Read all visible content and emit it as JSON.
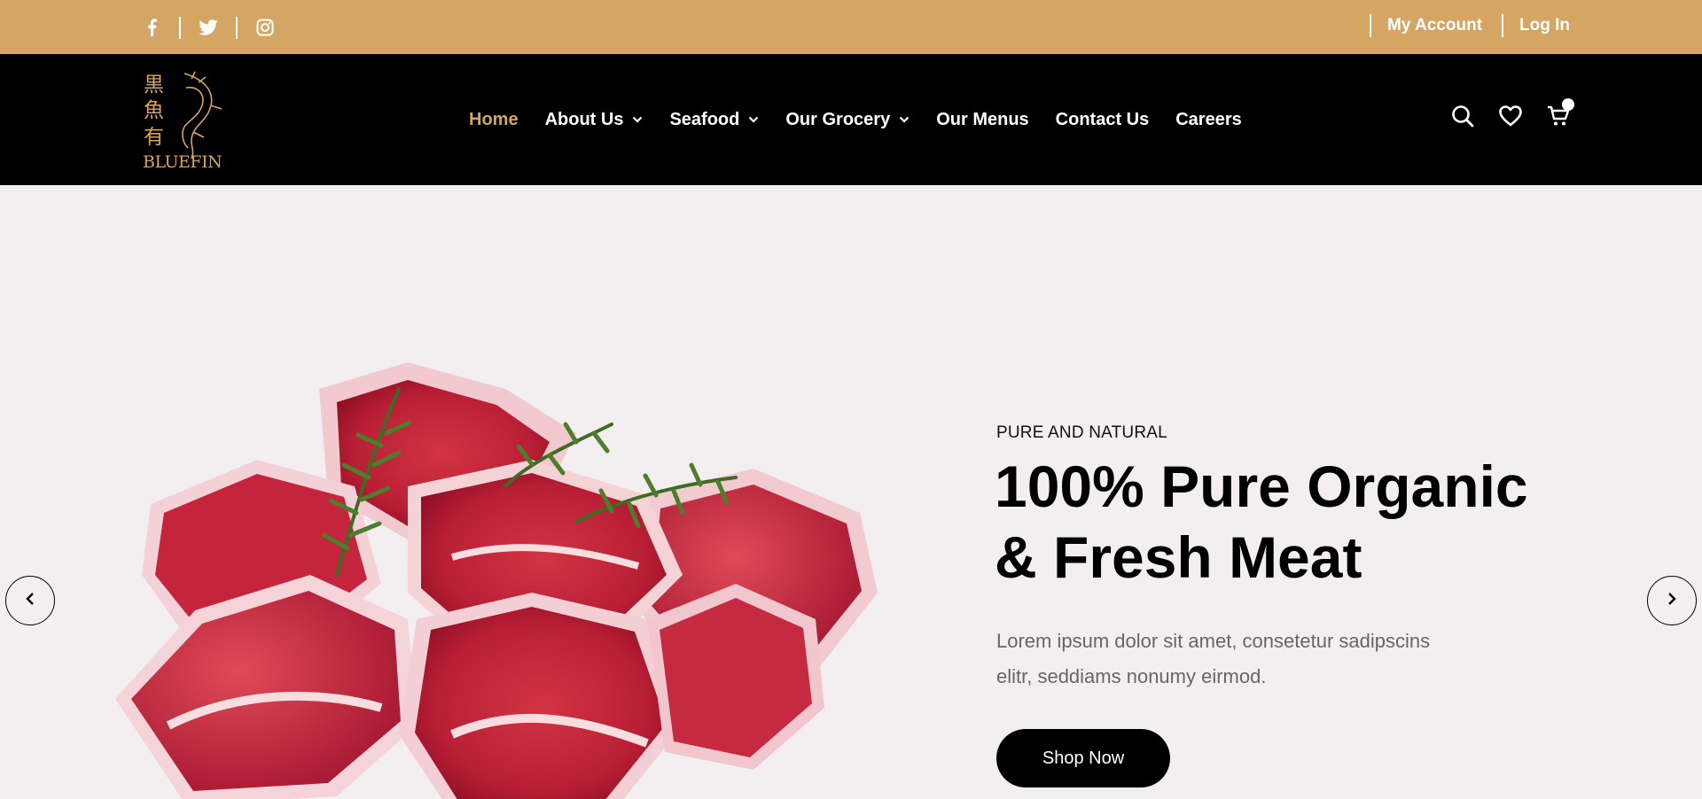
{
  "topbar": {
    "social": [
      {
        "icon": "facebook-icon"
      },
      {
        "icon": "twitter-icon"
      },
      {
        "icon": "instagram-icon"
      }
    ],
    "my_account": "My Account",
    "log_in": "Log In"
  },
  "header": {
    "logo": {
      "chinese": "黒魚有",
      "name": "BLUEFIN"
    },
    "nav": [
      {
        "label": "Home",
        "active": true
      },
      {
        "label": "About Us",
        "dropdown": true
      },
      {
        "label": "Seafood",
        "dropdown": true
      },
      {
        "label": "Our Grocery",
        "dropdown": true
      },
      {
        "label": "Our Menus"
      },
      {
        "label": "Contact Us"
      },
      {
        "label": "Careers"
      }
    ],
    "tools": [
      "search-icon",
      "heart-icon",
      "cart-icon"
    ],
    "cart_count": ""
  },
  "hero": {
    "eyebrow": "PURE AND NATURAL",
    "headline_line1": "100% Pure Organic",
    "headline_line2": "& Fresh Meat",
    "description_line1": "Lorem ipsum dolor sit amet, consetetur sadipscins",
    "description_line2": "elitr, seddiams nonumy eirmod.",
    "button": "Shop Now"
  },
  "colors": {
    "accent": "#d4a563",
    "header_bg": "#000000",
    "hero_bg": "#f3eff1"
  }
}
